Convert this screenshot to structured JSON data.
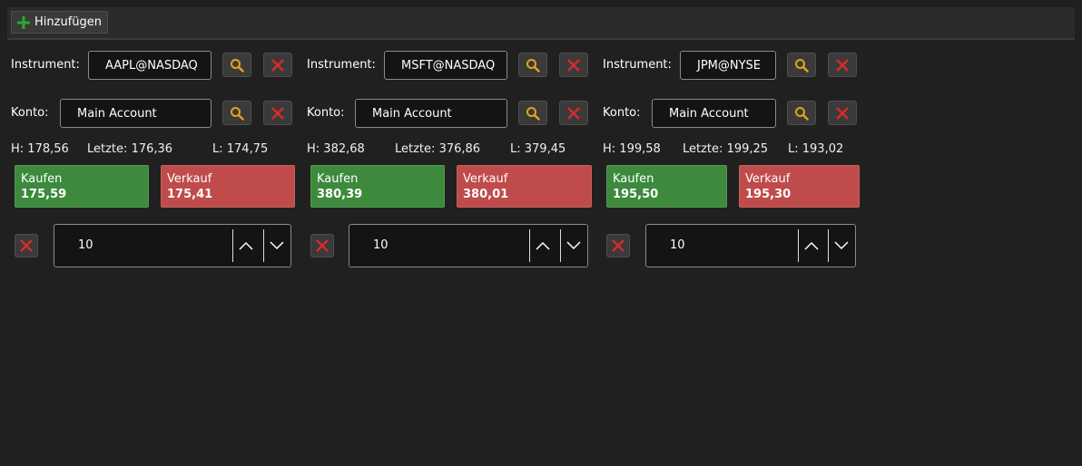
{
  "toolbar": {
    "add_label": "Hinzufügen"
  },
  "labels": {
    "instrument": "Instrument:",
    "account": "Konto:",
    "high": "H:",
    "last": "Letzte:",
    "low": "L:",
    "buy": "Kaufen",
    "sell": "Verkauf"
  },
  "panels": [
    {
      "instrument": "AAPL@NASDAQ",
      "account": "Main Account",
      "high": "178,56",
      "last": "176,36",
      "low": "174,75",
      "buy_price": "175,59",
      "sell_price": "175,41",
      "quantity": "10"
    },
    {
      "instrument": "MSFT@NASDAQ",
      "account": "Main Account",
      "high": "382,68",
      "last": "376,86",
      "low": "379,45",
      "buy_price": "380,39",
      "sell_price": "380,01",
      "quantity": "10"
    },
    {
      "instrument": "JPM@NYSE",
      "account": "Main Account",
      "high": "199,58",
      "last": "199,25",
      "low": "193,02",
      "buy_price": "195,50",
      "sell_price": "195,30",
      "quantity": "10"
    }
  ],
  "icons": {
    "add": "plus-icon",
    "search": "search-icon",
    "remove": "close-icon",
    "up": "chevron-up-icon",
    "down": "chevron-down-icon"
  },
  "colors": {
    "buy": "#3d8a3d",
    "sell": "#bf4b4b",
    "search_icon": "#e8a317",
    "remove_icon": "#d62b2b",
    "add_icon": "#2ea82e"
  }
}
